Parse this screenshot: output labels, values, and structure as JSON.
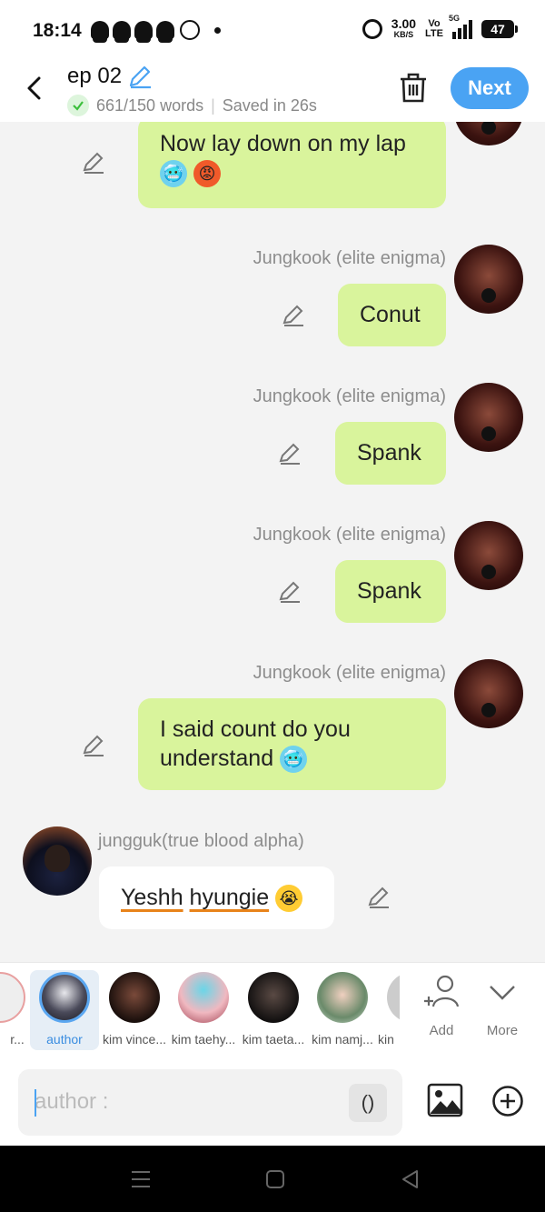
{
  "status_bar": {
    "time": "18:14",
    "net_speed": "3.00",
    "net_unit": "KB/S",
    "volte_top": "Vo",
    "volte_bottom": "LTE",
    "network": "5G",
    "battery": "47"
  },
  "header": {
    "title": "ep 02",
    "word_count": "661/150 words",
    "saved": "Saved in 26s",
    "next_label": "Next"
  },
  "messages": [
    {
      "sender": "",
      "text": "Now lay down on my lap"
    },
    {
      "sender": "Jungkook (elite enigma)",
      "text": "Conut"
    },
    {
      "sender": "Jungkook (elite enigma)",
      "text": "Spank"
    },
    {
      "sender": "Jungkook (elite enigma)",
      "text": "Spank"
    },
    {
      "sender": "Jungkook (elite enigma)",
      "text_line1": "I said count do you",
      "text_line2": "understand"
    },
    {
      "sender": "jungguk(true blood alpha)",
      "text_part1": "Yeshh",
      "text_part2": "hyungie"
    }
  ],
  "characters": [
    {
      "name": "r..."
    },
    {
      "name": "author"
    },
    {
      "name": "kim vince..."
    },
    {
      "name": "kim taehy..."
    },
    {
      "name": "kim taeta..."
    },
    {
      "name": "kim namj..."
    },
    {
      "name": "kin"
    }
  ],
  "char_actions": {
    "add": "Add",
    "more": "More"
  },
  "input": {
    "placeholder": "author :",
    "paren": "()"
  },
  "colors": {
    "accent": "#4aa3f3",
    "bubble": "#d9f49c",
    "background": "#f3f3f3"
  }
}
